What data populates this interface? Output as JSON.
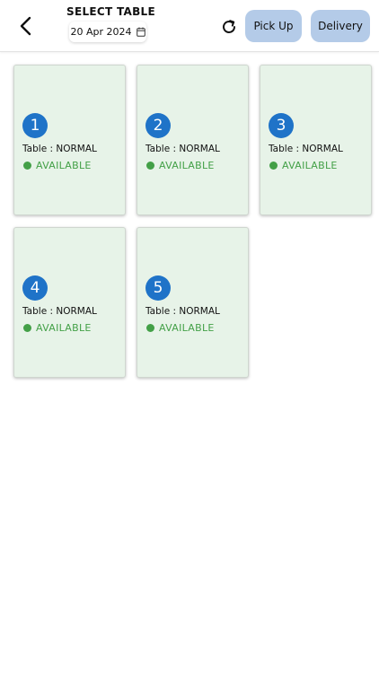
{
  "header": {
    "title": "SELECT TABLE",
    "date": "20 Apr 2024",
    "pickup_label": "Pick Up",
    "delivery_label": "Delivery",
    "back_icon": "chevron-left-icon",
    "refresh_icon": "refresh-icon",
    "calendar_icon": "calendar-icon"
  },
  "tables": [
    {
      "number": "1",
      "type": "Table : NORMAL",
      "status": "AVAILABLE"
    },
    {
      "number": "2",
      "type": "Table : NORMAL",
      "status": "AVAILABLE"
    },
    {
      "number": "3",
      "type": "Table : NORMAL",
      "status": "AVAILABLE"
    },
    {
      "number": "4",
      "type": "Table : NORMAL",
      "status": "AVAILABLE"
    },
    {
      "number": "5",
      "type": "Table : NORMAL",
      "status": "AVAILABLE"
    }
  ],
  "colors": {
    "card_bg": "#e7f3e8",
    "badge": "#1f73c8",
    "available": "#43a047",
    "button_bg": "#b4cbe8"
  }
}
